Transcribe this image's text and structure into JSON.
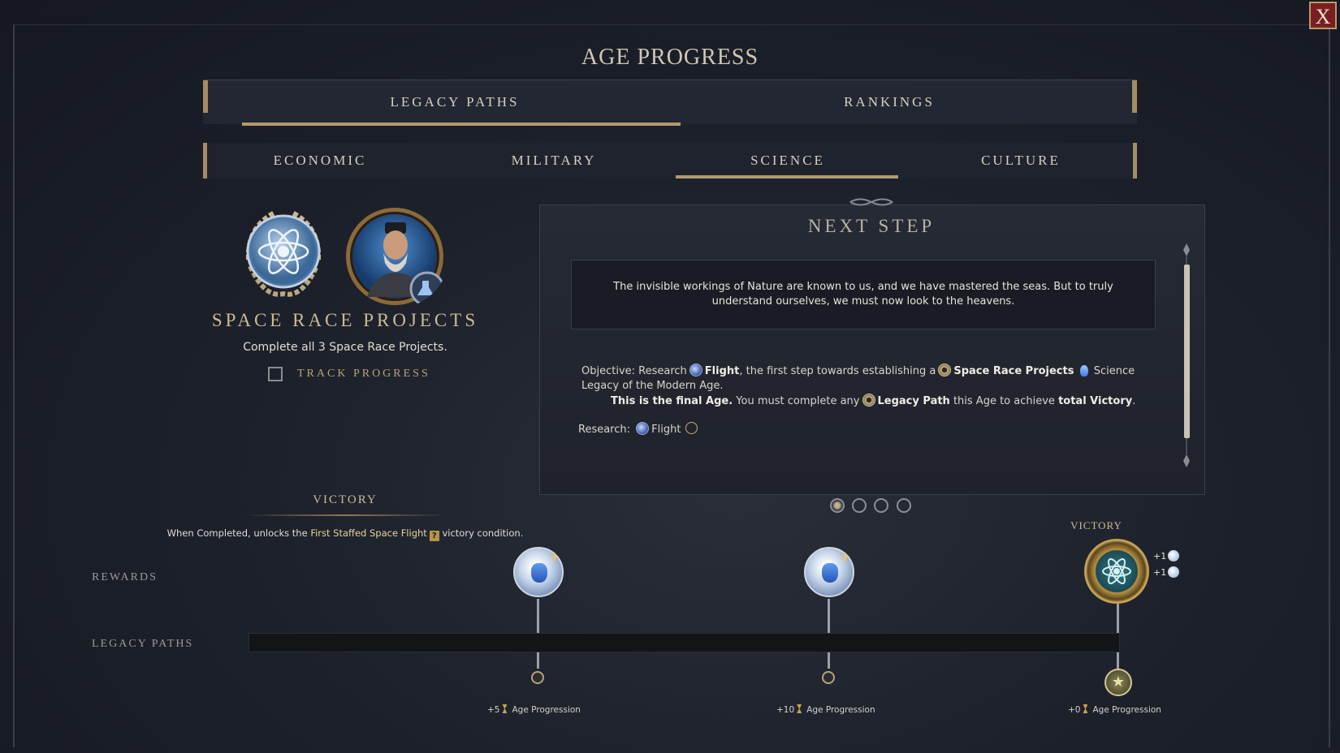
{
  "window": {
    "title": "AGE PROGRESS",
    "close_label": "X"
  },
  "main_tabs": [
    {
      "label": "LEGACY PATHS",
      "selected": true
    },
    {
      "label": "RANKINGS",
      "selected": false
    }
  ],
  "sub_tabs": [
    {
      "label": "ECONOMIC",
      "selected": false
    },
    {
      "label": "MILITARY",
      "selected": false
    },
    {
      "label": "SCIENCE",
      "selected": true
    },
    {
      "label": "CULTURE",
      "selected": false
    }
  ],
  "project": {
    "title": "SPACE RACE PROJECTS",
    "description": "Complete all 3 Space Race Projects.",
    "track_label": "TRACK PROGRESS",
    "track_checked": false,
    "emblem_icon": "atom-laurel-icon",
    "leader_icon": "leader-portrait-icon"
  },
  "next_step": {
    "title": "NEXT STEP",
    "quote": "The invisible workings of Nature are known to us, and we have mastered the seas. But to truly understand ourselves, we must now look to the heavens.",
    "objective": {
      "prefix": "Objective: Research",
      "tech": "Flight",
      "mid": ", the first step towards establishing a",
      "legacy": "Space Race Projects",
      "science": "Science",
      "suffix": "Legacy of the Modern Age."
    },
    "final_age": {
      "bold1": "This is the final Age.",
      "text1": "You must complete any",
      "legacy_path": "Legacy Path",
      "text2": "this Age to achieve",
      "bold2": "total Victory",
      "end": "."
    },
    "research": {
      "label": "Research:",
      "tech": "Flight",
      "done": false
    },
    "pages": 4,
    "current_page": 1
  },
  "victory": {
    "heading": "VICTORY",
    "desc_prefix": "When Completed, unlocks the",
    "desc_link": "First Staffed Space Flight",
    "desc_suffix": "victory condition."
  },
  "rows": {
    "rewards": "REWARDS",
    "legacy_paths": "LEGACY PATHS"
  },
  "milestones": [
    {
      "amount": "+5",
      "label": "Age Progression",
      "reward_icon": "science-flask-plus-icon"
    },
    {
      "amount": "+10",
      "label": "Age Progression",
      "reward_icon": "science-flask-plus-icon"
    },
    {
      "amount": "+0",
      "label": "Age Progression",
      "reward_icon": "victory-medal-icon",
      "reward_label": "VICTORY",
      "bonus": [
        "+1",
        "+1"
      ]
    }
  ],
  "progress_fraction": 0.0,
  "colors": {
    "accent_gold": "#b39a6c",
    "close_red": "#7a1e22",
    "panel_bg": "#262a34"
  }
}
